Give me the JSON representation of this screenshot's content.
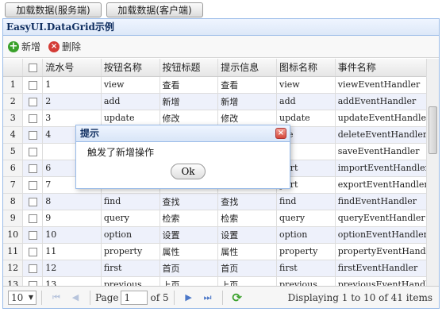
{
  "top_buttons": {
    "server": "加载数据(服务端)",
    "client": "加载数据(客户端)"
  },
  "panel": {
    "title": "EasyUI.DataGrid示例"
  },
  "toolbar": {
    "add": "新增",
    "delete": "删除"
  },
  "columns": [
    "流水号",
    "按钮名称",
    "按钮标题",
    "提示信息",
    "图标名称",
    "事件名称"
  ],
  "rows": [
    {
      "rn": "1",
      "id": "1",
      "name": "view",
      "title": "查看",
      "tip": "查看",
      "icon": "view",
      "event": "viewEventHandler"
    },
    {
      "rn": "2",
      "id": "2",
      "name": "add",
      "title": "新增",
      "tip": "新增",
      "icon": "add",
      "event": "addEventHandler"
    },
    {
      "rn": "3",
      "id": "3",
      "name": "update",
      "title": "修改",
      "tip": "修改",
      "icon": "update",
      "event": "updateEventHandler"
    },
    {
      "rn": "4",
      "id": "4",
      "name": "",
      "title": "",
      "tip": "",
      "icon": "ete",
      "event": "deleteEventHandler"
    },
    {
      "rn": "5",
      "id": "",
      "name": "",
      "title": "",
      "tip": "",
      "icon": "",
      "event": "saveEventHandler"
    },
    {
      "rn": "6",
      "id": "6",
      "name": "",
      "title": "",
      "tip": "",
      "icon": "port",
      "event": "importEventHandler"
    },
    {
      "rn": "7",
      "id": "7",
      "name": "",
      "title": "",
      "tip": "",
      "icon": "port",
      "event": "exportEventHandler"
    },
    {
      "rn": "8",
      "id": "8",
      "name": "find",
      "title": "查找",
      "tip": "查找",
      "icon": "find",
      "event": "findEventHandler"
    },
    {
      "rn": "9",
      "id": "9",
      "name": "query",
      "title": "检索",
      "tip": "检索",
      "icon": "query",
      "event": "queryEventHandler"
    },
    {
      "rn": "10",
      "id": "10",
      "name": "option",
      "title": "设置",
      "tip": "设置",
      "icon": "option",
      "event": "optionEventHandler"
    },
    {
      "rn": "11",
      "id": "11",
      "name": "property",
      "title": "属性",
      "tip": "属性",
      "icon": "property",
      "event": "propertyEventHandler"
    },
    {
      "rn": "12",
      "id": "12",
      "name": "first",
      "title": "首页",
      "tip": "首页",
      "icon": "first",
      "event": "firstEventHandler"
    },
    {
      "rn": "13",
      "id": "13",
      "name": "previous",
      "title": "上页",
      "tip": "上页",
      "icon": "previous",
      "event": "previousEventHandler"
    }
  ],
  "pager": {
    "page_size": "10",
    "page_label": "Page",
    "page": "1",
    "of_label": "of 5",
    "display": "Displaying 1 to 10 of 41 items"
  },
  "dialog": {
    "title": "提示",
    "message": "触发了新增操作",
    "ok": "Ok"
  }
}
